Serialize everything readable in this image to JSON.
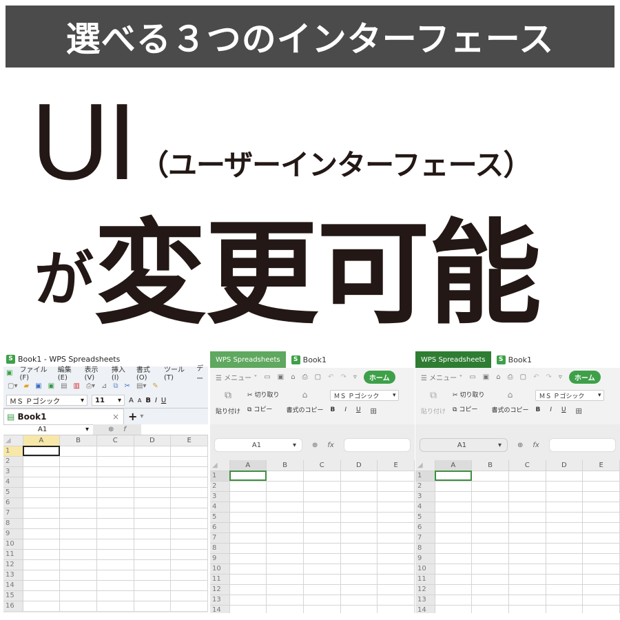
{
  "banner": {
    "text": "選べる３つのインターフェース",
    "bg": "#4b4b4b"
  },
  "headline": {
    "ui": "UI",
    "ui_sub": "（ユーザーインターフェース）",
    "ga": "が",
    "main": "変更可能"
  },
  "panel1": {
    "title": "Book1 - WPS Spreadsheets",
    "menu": [
      "ファイル(F)",
      "編集(E)",
      "表示(V)",
      "挿入(I)",
      "書式(O)",
      "ツール(T)",
      "デー"
    ],
    "font_name": "ＭＳ Ｐゴシック",
    "font_size": "11",
    "format_buttons": [
      "A",
      "A",
      "B",
      "I",
      "U"
    ],
    "doc_tab": "Book1",
    "close": "×",
    "add": "+",
    "cell_ref": "A1",
    "columns": [
      "A",
      "B",
      "C",
      "D",
      "E"
    ],
    "rows": [
      "1",
      "2",
      "3",
      "4",
      "5",
      "6",
      "7",
      "8",
      "9",
      "10",
      "11",
      "12",
      "13",
      "14",
      "15",
      "16"
    ]
  },
  "panel2": {
    "app_tab": "WPS Spreadsheets",
    "file_tab": "Book1",
    "accent": "#5fa85f",
    "menu": "メニュー",
    "home": "ホーム",
    "paste": "貼り付け",
    "cut": "切り取り",
    "copy": "コピー",
    "format_painter": "書式のコピー",
    "format_painter2": "貼り付け",
    "font_name": "ＭＳ Ｐゴシック",
    "format_buttons": [
      "B",
      "I",
      "U",
      "田"
    ],
    "cell_ref": "A1",
    "fx": "fx",
    "columns": [
      "A",
      "B",
      "C",
      "D",
      "E"
    ],
    "rows": [
      "1",
      "2",
      "3",
      "4",
      "5",
      "6",
      "7",
      "8",
      "9",
      "10",
      "11",
      "12",
      "13",
      "14"
    ]
  },
  "panel3": {
    "app_tab": "WPS Spreadsheets",
    "file_tab": "Book1",
    "accent": "#2e7d32",
    "menu": "メニュー",
    "home": "ホーム",
    "paste": "貼り付け",
    "cut": "切り取り",
    "copy": "コピー",
    "format_painter": "書式のコピー",
    "format_painter2": "貼り付け",
    "font_name": "ＭＳ Ｐゴシック",
    "format_buttons": [
      "B",
      "I",
      "U",
      "田"
    ],
    "cell_ref": "A1",
    "fx": "fx",
    "columns": [
      "A",
      "B",
      "C",
      "D",
      "E"
    ],
    "rows": [
      "1",
      "2",
      "3",
      "4",
      "5",
      "6",
      "7",
      "8",
      "9",
      "10",
      "11",
      "12",
      "13",
      "14"
    ]
  }
}
